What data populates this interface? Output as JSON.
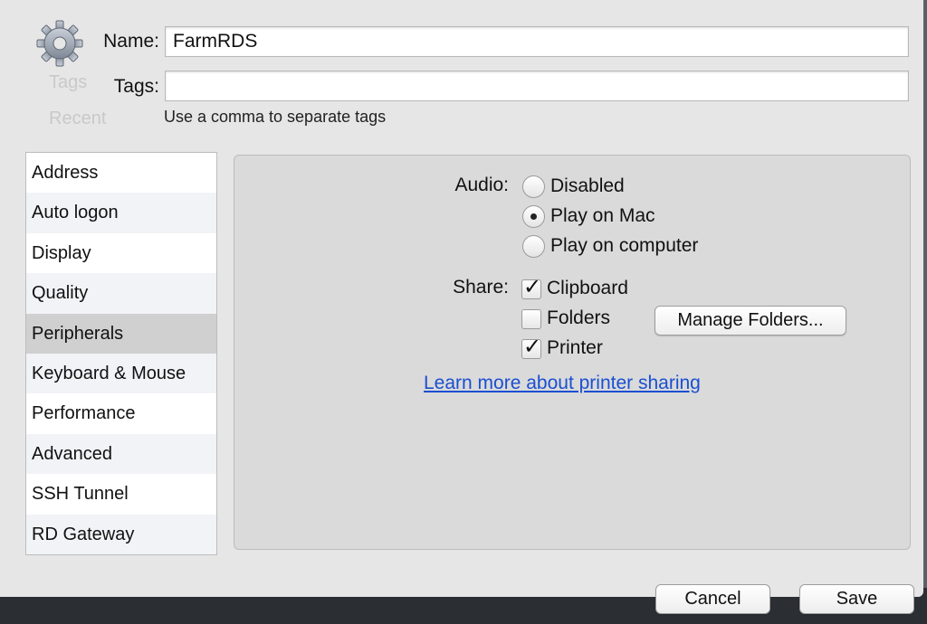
{
  "header": {
    "name_label": "Name:",
    "name_value": "FarmRDS",
    "tags_label": "Tags:",
    "tags_value": "",
    "tags_hint": "Use a comma to separate tags",
    "icon": "gear-icon"
  },
  "background_ghost": {
    "tags": "Tags",
    "recent": "Recent"
  },
  "sidebar": {
    "selected": "Peripherals",
    "items": [
      {
        "label": "Address"
      },
      {
        "label": "Auto logon"
      },
      {
        "label": "Display"
      },
      {
        "label": "Quality"
      },
      {
        "label": "Peripherals"
      },
      {
        "label": "Keyboard & Mouse"
      },
      {
        "label": "Performance"
      },
      {
        "label": "Advanced"
      },
      {
        "label": "SSH Tunnel"
      },
      {
        "label": "RD Gateway"
      }
    ]
  },
  "peripherals": {
    "audio_label": "Audio:",
    "audio_options": [
      {
        "label": "Disabled",
        "selected": false
      },
      {
        "label": "Play on Mac",
        "selected": true
      },
      {
        "label": "Play on computer",
        "selected": false
      }
    ],
    "share_label": "Share:",
    "share_options": [
      {
        "label": "Clipboard",
        "checked": true
      },
      {
        "label": "Folders",
        "checked": false
      },
      {
        "label": "Printer",
        "checked": true
      }
    ],
    "manage_folders_label": "Manage Folders...",
    "learn_more_link": "Learn more about printer sharing"
  },
  "footer": {
    "cancel_label": "Cancel",
    "save_label": "Save"
  },
  "colors": {
    "link": "#1a4fd1",
    "selected_row": "#d0d0d0",
    "panel_bg": "#dadada"
  }
}
